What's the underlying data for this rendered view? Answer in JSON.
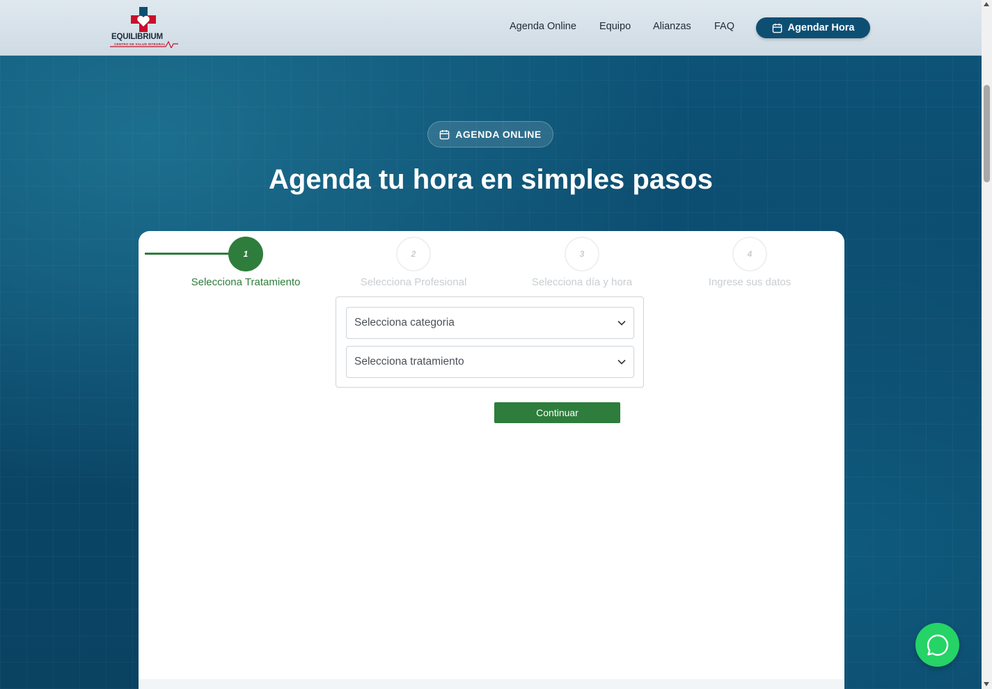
{
  "header": {
    "logo": {
      "name": "EQUILIBRIUM",
      "tagline": "CENTRO DE SALUD INTEGRAL"
    },
    "nav": [
      {
        "label": "Agenda Online"
      },
      {
        "label": "Equipo"
      },
      {
        "label": "Alianzas"
      },
      {
        "label": "FAQ"
      }
    ],
    "cta_label": "Agendar Hora"
  },
  "hero": {
    "badge": "AGENDA ONLINE",
    "title": "Agenda tu hora en simples pasos"
  },
  "wizard": {
    "steps": [
      {
        "number": "1",
        "label": "Selecciona Tratamiento",
        "state": "active"
      },
      {
        "number": "2",
        "label": "Selecciona Profesional",
        "state": "inactive"
      },
      {
        "number": "3",
        "label": "Selecciona día y hora",
        "state": "inactive"
      },
      {
        "number": "4",
        "label": "Ingrese sus datos",
        "state": "inactive"
      }
    ],
    "category_select": {
      "value": "Selecciona categoria"
    },
    "treatment_select": {
      "value": "Selecciona tratamiento"
    },
    "continue_label": "Continuar"
  },
  "icons": {
    "calendar": "calendar-icon",
    "chevron": "chevron-down-icon",
    "whatsapp": "whatsapp-icon"
  },
  "colors": {
    "primary_blue": "#0d4f73",
    "accent_green": "#2e7d3c",
    "whatsapp_green": "#25d366",
    "logo_red": "#c8102e"
  }
}
